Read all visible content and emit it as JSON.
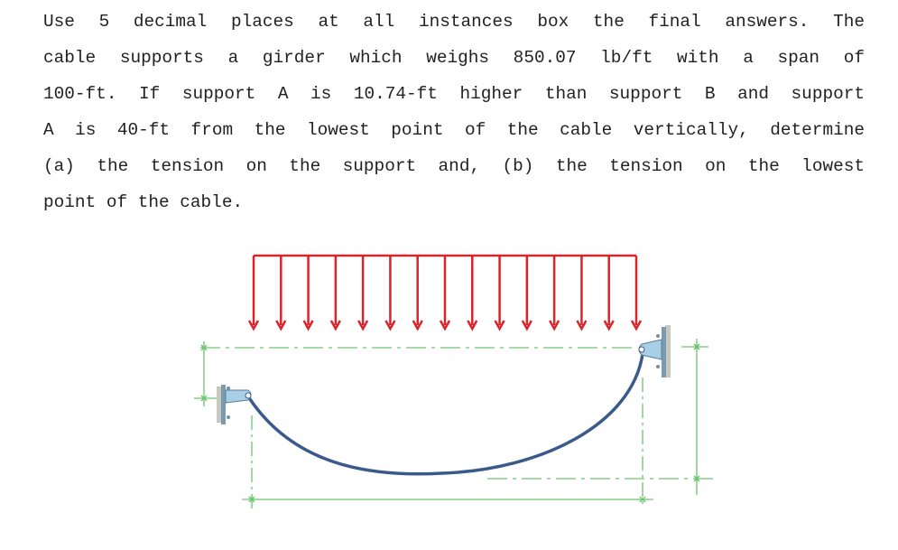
{
  "problem": {
    "lines": [
      "Use 5 decimal places at all instances box the final answers. The",
      "cable supports a girder which weighs 850.07 lb/ft with a span of",
      "100-ft. If support A is 10.74-ft higher than support B and support",
      "A is 40-ft from the lowest point of the cable vertically, determine",
      "(a) the tension on the support and, (b) the tension on the lowest",
      "point of the cable."
    ]
  },
  "figure": {
    "load_color": "#d9242a",
    "cable_color": "#3a5a8c",
    "dimension_color": "#6cc46f",
    "support_color": "#a8cfe6",
    "load_arrow_count": 15
  }
}
